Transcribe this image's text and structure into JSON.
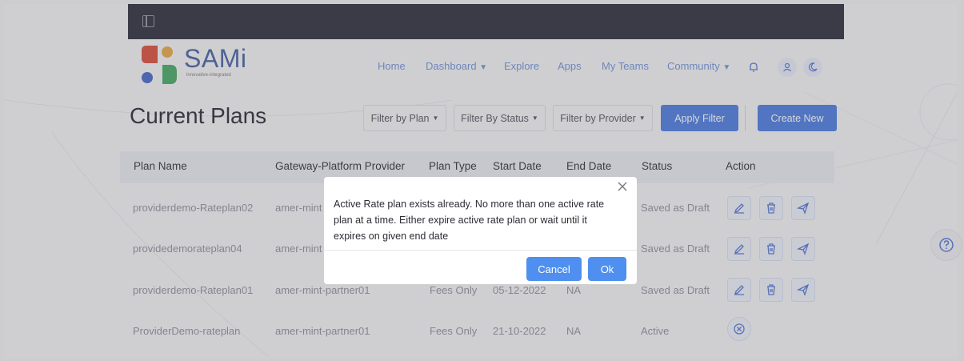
{
  "header": {
    "logo_text": "SAMi",
    "logo_tagline": "innovative-integrated",
    "nav": {
      "home": "Home",
      "dashboard": "Dashboard",
      "explore": "Explore",
      "apps": "Apps",
      "my_teams": "My Teams",
      "community": "Community"
    },
    "icons": [
      "bell-icon",
      "user-icon",
      "moon-icon"
    ]
  },
  "page": {
    "title": "Current Plans",
    "filters": {
      "plan": "Filter by Plan",
      "status": "Filter By Status",
      "provider": "Filter by Provider"
    },
    "apply_filter": "Apply Filter",
    "create_new": "Create New"
  },
  "table": {
    "columns": [
      "Plan Name",
      "Gateway-Platform Provider",
      "Plan Type",
      "Start Date",
      "End Date",
      "Status",
      "Action"
    ],
    "rows": [
      {
        "plan_name": "providerdemo-Rateplan02",
        "provider": "amer-mint",
        "plan_type": "",
        "start_date": "",
        "end_date": "",
        "status": "Saved as Draft",
        "actions": [
          "edit-icon",
          "trash-icon",
          "send-icon"
        ]
      },
      {
        "plan_name": "providedemorateplan04",
        "provider": "amer-mint",
        "plan_type": "",
        "start_date": "",
        "end_date": "",
        "status": "Saved as Draft",
        "actions": [
          "edit-icon",
          "trash-icon",
          "send-icon"
        ]
      },
      {
        "plan_name": "providerdemo-Rateplan01",
        "provider": "amer-mint-partner01",
        "plan_type": "Fees Only",
        "start_date": "05-12-2022",
        "end_date": "NA",
        "status": "Saved as Draft",
        "actions": [
          "edit-icon",
          "trash-icon",
          "send-icon"
        ]
      },
      {
        "plan_name": "ProviderDemo-rateplan",
        "provider": "amer-mint-partner01",
        "plan_type": "Fees Only",
        "start_date": "21-10-2022",
        "end_date": "NA",
        "status": "Active",
        "actions": [
          "expire-icon"
        ]
      }
    ]
  },
  "modal": {
    "message": "Active Rate plan exists already. No more than one active rate plan at a time. Either expire active rate plan or wait until it expires on given end date",
    "cancel": "Cancel",
    "ok": "Ok"
  },
  "colors": {
    "topbar": "#222230",
    "primary": "#4374e0",
    "modal_button": "#4f8ff0",
    "logo_red": "#d9442f",
    "logo_orange": "#e9a23b",
    "logo_blue": "#3a5fc4",
    "logo_green": "#3aa55a"
  }
}
